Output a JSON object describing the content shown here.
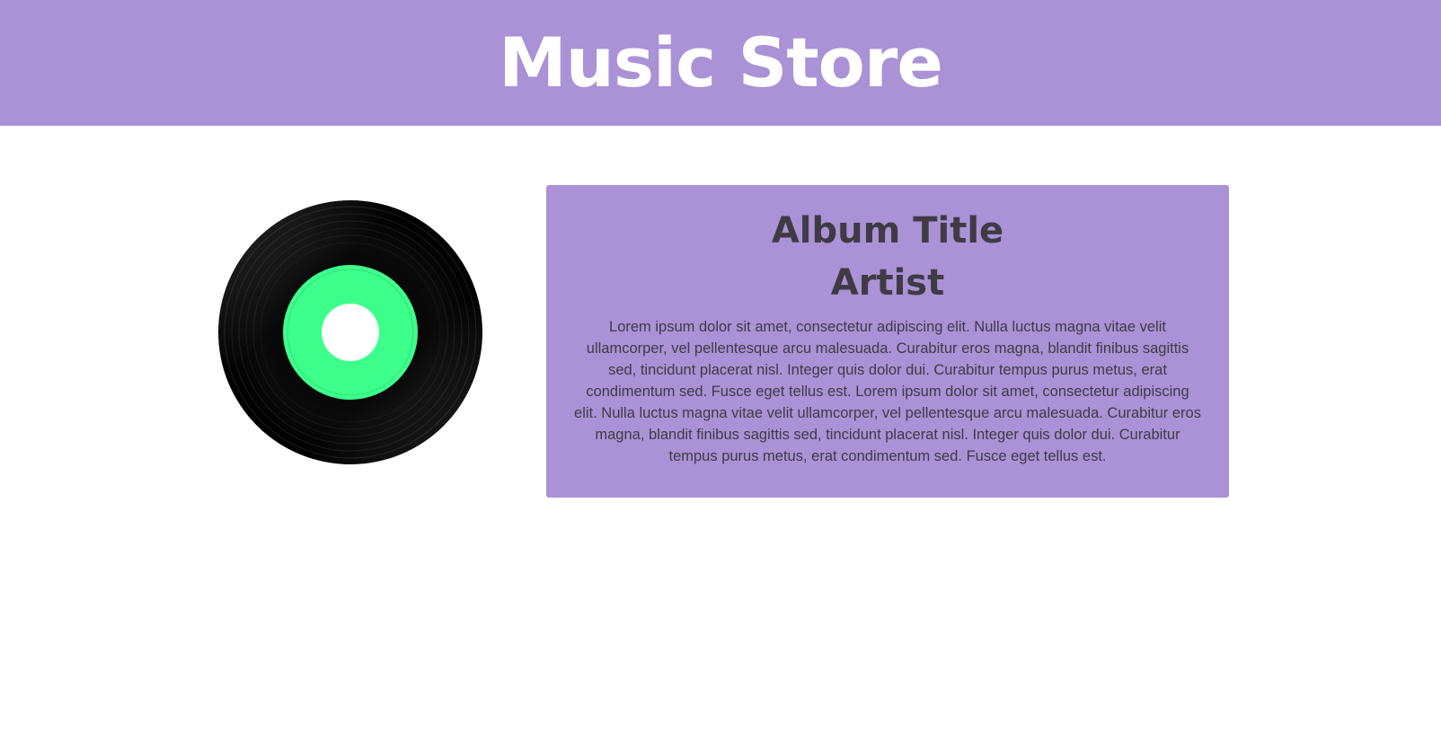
{
  "header": {
    "title": "Music Store"
  },
  "album": {
    "title": "Album Title",
    "artist": "Artist",
    "description": "Lorem ipsum dolor sit amet, consectetur adipiscing elit. Nulla luctus magna vitae velit ullamcorper, vel pellentesque arcu malesuada. Curabitur eros magna, blandit finibus sagittis sed, tincidunt placerat nisl. Integer quis dolor dui. Curabitur tempus purus metus, erat condimentum sed. Fusce eget tellus est. Lorem ipsum dolor sit amet, consectetur adipiscing elit. Nulla luctus magna vitae velit ullamcorper, vel pellentesque arcu malesuada. Curabitur eros magna, blandit finibus sagittis sed, tincidunt placerat nisl. Integer quis dolor dui. Curabitur tempus purus metus, erat condimentum sed. Fusce eget tellus est."
  },
  "colors": {
    "header_bg": "#a992d5",
    "card_bg": "#a992d5",
    "text_dark": "#3f3b45",
    "record_black": "#050505",
    "record_label": "#3dff8c"
  },
  "record": {
    "icon": "vinyl-record-icon"
  }
}
